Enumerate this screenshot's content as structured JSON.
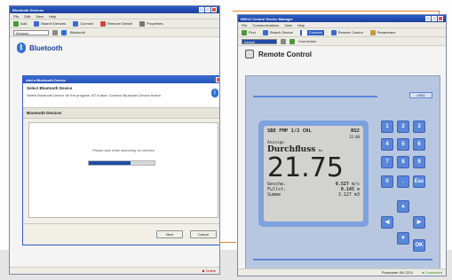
{
  "left_window": {
    "title": "Bluetooth Devices",
    "menu": [
      "File",
      "Edit",
      "View",
      "Help"
    ],
    "toolbar": [
      "Add",
      "Search Devices",
      "Connect",
      "Remove Device",
      "Properties"
    ],
    "address_value": "Devices",
    "address_label": "Bluetooth",
    "section_title": "Bluetooth",
    "status_text": "",
    "dialog": {
      "title": "Add a Bluetooth Device",
      "header_title": "Select Bluetooth Device",
      "header_text": "Select Bluetooth Device for the program. BT button: Connect Bluetooth Device button",
      "section": "Bluetooth Devices",
      "message": "Please wait while searching for devices",
      "progress": 0.63,
      "btn_next": "Next",
      "btn_cancel": "Cancel"
    },
    "status_right": "Online"
  },
  "right_window": {
    "title": "EMCO Control Device Manager",
    "menu": [
      "File",
      "Communications",
      "View",
      "Help"
    ],
    "toolbar": [
      "Find",
      "Search Device",
      "Connect",
      "Remote Control",
      "Parameters"
    ],
    "address_value": "Device",
    "address_label": "Connection",
    "section_title": "Remote Control",
    "mini_field": "0000",
    "status_center": "Flowmeter SN 2210",
    "status_right": "Connected",
    "lcd": {
      "header_left": "SBE FMP 1/2 CHL",
      "header_right": "RS2",
      "sub_left": "",
      "sub_right": "12:00",
      "label": "Anzeige",
      "name": "Durchfluss",
      "unit": "l/s",
      "value": "21.75",
      "rows": [
        {
          "label": "Geschw.",
          "value": "0.527",
          "unit": "m/s"
        },
        {
          "label": "Fullst.",
          "value": "0.145",
          "unit": "m"
        },
        {
          "label": "Summe",
          "value": "3.127",
          "unit": "m3"
        }
      ]
    },
    "keys": [
      "1",
      "2",
      "3",
      "4",
      "5",
      "6",
      "7",
      "8",
      "9",
      "0",
      ".",
      "Esc",
      "▲",
      "◀",
      "▶",
      "▼",
      "OK"
    ]
  },
  "colors": {
    "accent": "#e8832a",
    "titlebar": "#1a3f9e",
    "lcd_frame": "#7ea2df",
    "device_bg": "#b8c7e0"
  }
}
